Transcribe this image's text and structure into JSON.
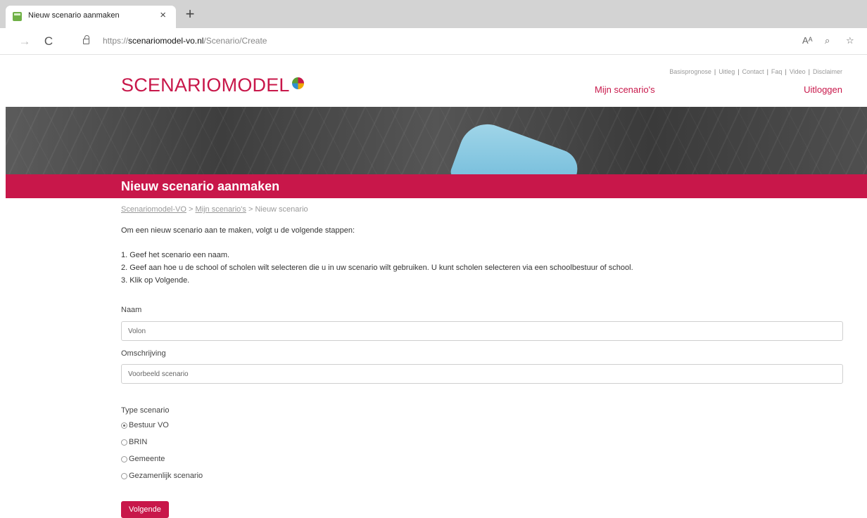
{
  "browser": {
    "tab_title": "Nieuw scenario aanmaken",
    "tab_close_icon": "close-icon",
    "new_tab_label": "+",
    "url_scheme": "https://",
    "url_host": "scenariomodel-vo.nl",
    "url_path": "/Scenario/Create",
    "read_aloud_label": "Aᴬ",
    "back_glyph": "→",
    "reload_glyph": "C",
    "zoom_glyph": "⌕",
    "favorite_glyph": "☆"
  },
  "header": {
    "logo_text": "SCENARIOMODEL",
    "top_links": [
      "Basisprognose",
      "Uitleg",
      "Contact",
      "Faq",
      "Video",
      "Disclaimer"
    ],
    "my_scenarios": "Mijn scenario's",
    "logout": "Uitloggen"
  },
  "page": {
    "title": "Nieuw scenario aanmaken",
    "breadcrumb": {
      "home": "Scenariomodel-VO",
      "sep1": " > ",
      "mine": "Mijn scenario's",
      "sep2": " > ",
      "current": "Nieuw scenario"
    },
    "intro": "Om een nieuw scenario aan te maken, volgt u de volgende stappen:",
    "steps": [
      "1. Geef het scenario een naam.",
      "2. Geef aan hoe u de school of scholen wilt selecteren die u in uw scenario wilt gebruiken. U kunt scholen selecteren via een schoolbestuur of school.",
      "3. Klik op Volgende."
    ]
  },
  "form": {
    "name_label": "Naam",
    "name_value": "Volon",
    "description_label": "Omschrijving",
    "description_value": "Voorbeeld scenario",
    "type_label": "Type scenario",
    "type_options": [
      {
        "label": "Bestuur VO",
        "checked": true
      },
      {
        "label": "BRIN",
        "checked": false
      },
      {
        "label": "Gemeente",
        "checked": false
      },
      {
        "label": "Gezamenlijk scenario",
        "checked": false
      }
    ],
    "next_button": "Volgende"
  },
  "colors": {
    "brand": "#c8174a"
  }
}
